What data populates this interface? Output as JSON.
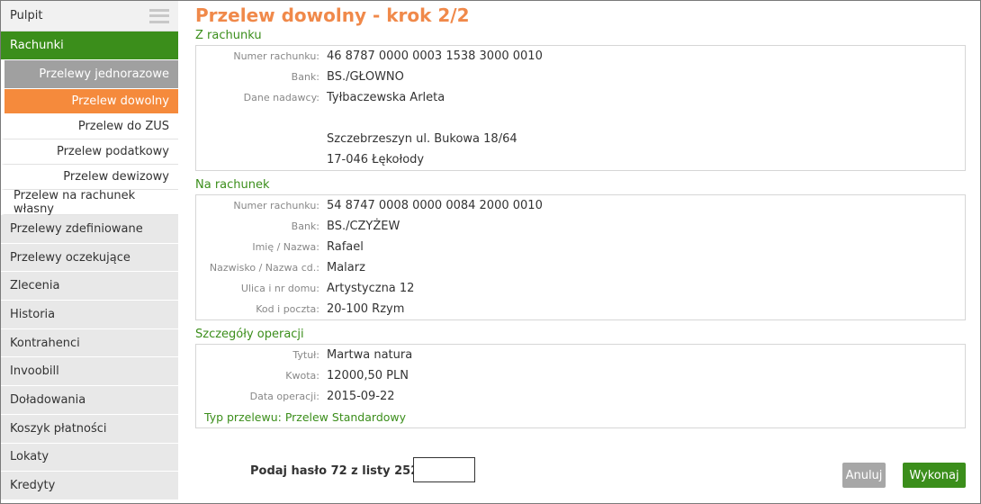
{
  "sidebar": {
    "top_label": "Pulpit",
    "active_section": "Rachunki",
    "group_label": "Przelewy jednorazowe",
    "sub_items": [
      {
        "label": "Przelew dowolny",
        "active": true
      },
      {
        "label": "Przelew do ZUS"
      },
      {
        "label": "Przelew podatkowy"
      },
      {
        "label": "Przelew dewizowy"
      },
      {
        "label": "Przelew na rachunek własny"
      }
    ],
    "items": [
      {
        "label": "Przelewy zdefiniowane"
      },
      {
        "label": "Przelewy oczekujące"
      },
      {
        "label": "Zlecenia"
      },
      {
        "label": "Historia"
      },
      {
        "label": "Kontrahenci"
      },
      {
        "label": "Invoobill"
      },
      {
        "label": "Doładowania"
      },
      {
        "label": "Koszyk płatności"
      },
      {
        "label": "Lokaty"
      },
      {
        "label": "Kredyty"
      }
    ]
  },
  "page": {
    "title": "Przelew dowolny - krok 2/2"
  },
  "from_account": {
    "section_title": "Z rachunku",
    "account_label": "Numer rachunku:",
    "account_value": "46 8787 0000 0003 1538 3000 0010",
    "bank_label": "Bank:",
    "bank_value": "BS./GŁOWNO",
    "sender_label": "Dane nadawcy:",
    "sender_name": "Tyłbaczewska Arleta",
    "sender_street": "Szczebrzeszyn ul. Bukowa 18/64",
    "sender_city": "17-046 Łękołody"
  },
  "to_account": {
    "section_title": "Na rachunek",
    "account_label": "Numer rachunku:",
    "account_value": "54 8747 0008 0000 0084 2000 0010",
    "bank_label": "Bank:",
    "bank_value": "BS./CZYŻEW",
    "name_label": "Imię / Nazwa:",
    "name_value": "Rafael",
    "surname_label": "Nazwisko / Nazwa cd.:",
    "surname_value": "Malarz",
    "street_label": "Ulica i nr domu:",
    "street_value": "Artystyczna 12",
    "postal_label": "Kod i poczta:",
    "postal_value": "20-100 Rzym"
  },
  "details": {
    "section_title": "Szczegóły operacji",
    "title_label": "Tytuł:",
    "title_value": "Martwa natura",
    "amount_label": "Kwota:",
    "amount_value": "12000,50 PLN",
    "date_label": "Data operacji:",
    "date_value": "2015-09-22",
    "transfer_type": "Typ przelewu: Przelew Standardowy"
  },
  "footer": {
    "password_prompt": "Podaj hasło 72 z listy 252:",
    "password_value": "",
    "cancel_label": "Anuluj",
    "execute_label": "Wykonaj"
  },
  "colors": {
    "accent_green": "#3b8e1b",
    "accent_orange": "#f58a3c",
    "title_orange": "#f0894a"
  }
}
